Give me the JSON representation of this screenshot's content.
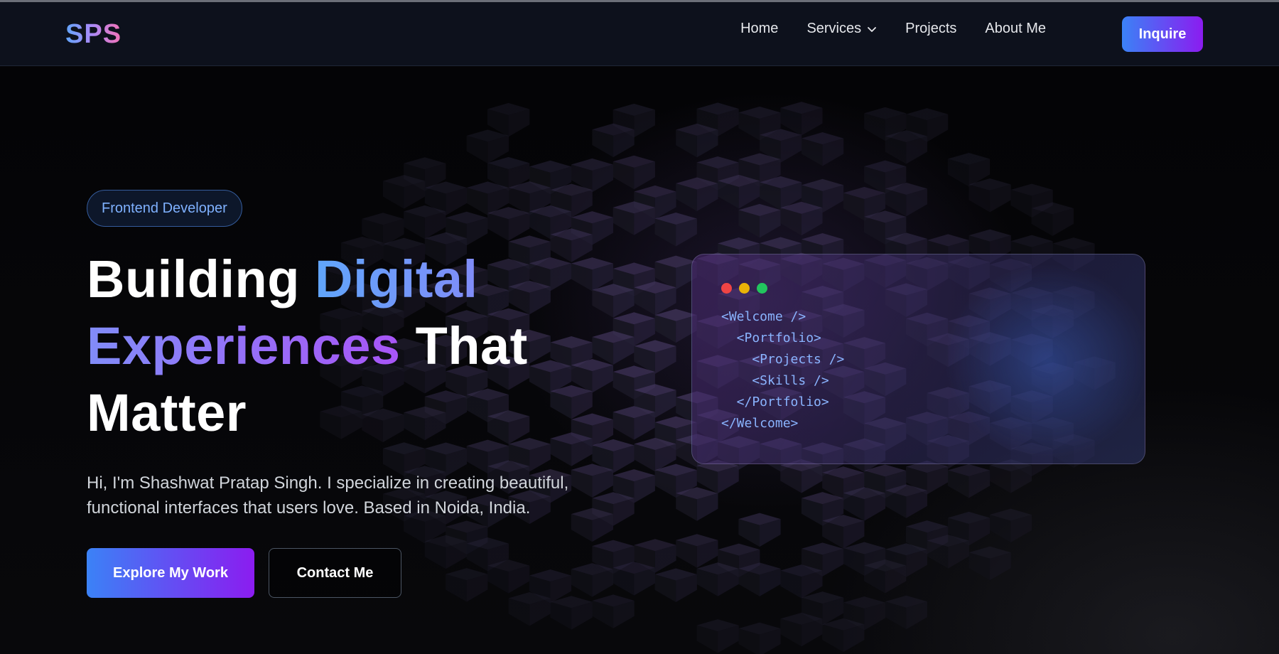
{
  "nav": {
    "logo": "SPS",
    "links": [
      {
        "label": "Home"
      },
      {
        "label": "Services",
        "has_dropdown": true
      },
      {
        "label": "Projects"
      },
      {
        "label": "About Me"
      }
    ],
    "cta_label": "Inquire"
  },
  "hero": {
    "badge": "Frontend Developer",
    "headline": {
      "part1": "Building ",
      "part2": "Digital",
      "part3": "Experiences",
      "part4": " That",
      "part5": "Matter"
    },
    "intro_line1": "Hi, I'm Shashwat Pratap Singh. I specialize in creating beautiful,",
    "intro_line2": "functional interfaces that users love. Based in Noida, India.",
    "primary_button": "Explore My Work",
    "secondary_button": "Contact Me"
  },
  "code_card": {
    "dots": [
      "#ef4444",
      "#eab308",
      "#22c55e"
    ],
    "lines": [
      "<Welcome />",
      "  <Portfolio>",
      "    <Projects />",
      "    <Skills />",
      "  </Portfolio>",
      "</Welcome>"
    ]
  },
  "colors": {
    "accent_blue": "#3b82f6",
    "accent_purple": "#8b1cf0",
    "nav_bg": "#0d111c",
    "code_text": "#8ab4ff"
  }
}
